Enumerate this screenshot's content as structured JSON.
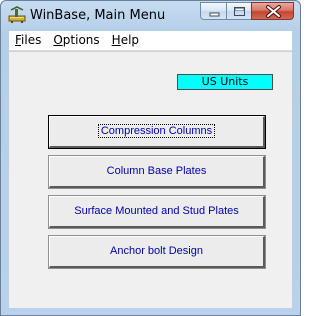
{
  "window": {
    "title": "WinBase, Main Menu"
  },
  "menubar": {
    "items": [
      {
        "label_acc": "F",
        "label_rest": "iles"
      },
      {
        "label_acc": "O",
        "label_rest": "ptions"
      },
      {
        "label_acc": "H",
        "label_rest": "elp"
      }
    ]
  },
  "units_badge": {
    "text": "US Units",
    "color": "#00ffff"
  },
  "buttons": [
    {
      "label": "Compression Columns"
    },
    {
      "label": "Column Base Plates"
    },
    {
      "label": "Surface Mounted and Stud Plates"
    },
    {
      "label": "Anchor bolt Design"
    }
  ],
  "colors": {
    "button_text": "#0000aa",
    "client_background": "#f0f0f0"
  }
}
